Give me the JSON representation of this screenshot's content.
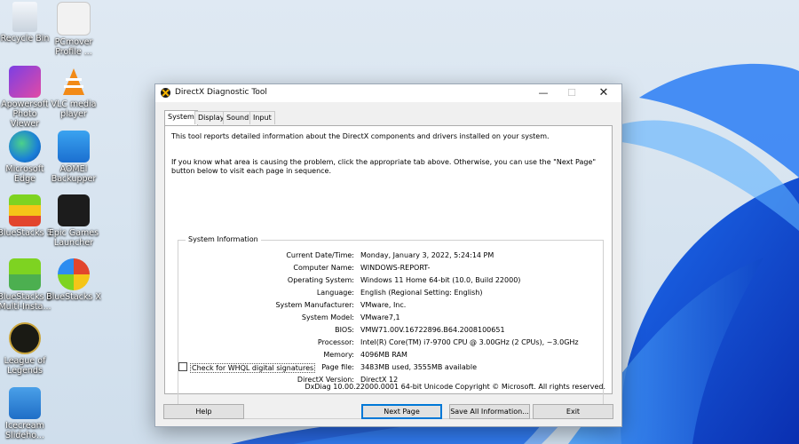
{
  "desktop": {
    "icons": [
      {
        "label": "Recycle Bin",
        "icon": "recycle-bin-icon"
      },
      {
        "label": "PCmover Profile ...",
        "icon": "pcmover-icon"
      },
      {
        "label": "Apowersoft Photo Viewer",
        "icon": "apowersoft-icon"
      },
      {
        "label": "VLC media player",
        "icon": "vlc-icon"
      },
      {
        "label": "Microsoft Edge",
        "icon": "edge-icon"
      },
      {
        "label": "AOMEI Backupper",
        "icon": "aomei-icon"
      },
      {
        "label": "BlueStacks 5",
        "icon": "bluestacks-icon"
      },
      {
        "label": "Epic Games Launcher",
        "icon": "epic-games-icon"
      },
      {
        "label": "BlueStacks 5 Multi-Insta...",
        "icon": "bluestacks-multi-icon"
      },
      {
        "label": "BlueStacks X",
        "icon": "bluestacks-x-icon"
      },
      {
        "label": "League of Legends",
        "icon": "league-icon"
      },
      {
        "label": "Icecream Slideho...",
        "icon": "icecream-icon"
      }
    ]
  },
  "window": {
    "title": "DirectX Diagnostic Tool",
    "minimize": "—",
    "maximize": "☐",
    "close": "✕",
    "tabs": [
      "System",
      "Display",
      "Sound",
      "Input"
    ],
    "intro": "This tool reports detailed information about the DirectX components and drivers installed on your system.",
    "hint": "If you know what area is causing the problem, click the appropriate tab above.  Otherwise, you can use the \"Next Page\" button below to visit each page in sequence.",
    "group_title": "System Information",
    "rows": [
      {
        "key": "Current Date/Time:",
        "value": "Monday, January 3, 2022, 5:24:14 PM"
      },
      {
        "key": "Computer Name:",
        "value": "WINDOWS-REPORT-"
      },
      {
        "key": "Operating System:",
        "value": "Windows 11 Home 64-bit (10.0, Build 22000)"
      },
      {
        "key": "Language:",
        "value": "English (Regional Setting: English)"
      },
      {
        "key": "System Manufacturer:",
        "value": "VMware, Inc."
      },
      {
        "key": "System Model:",
        "value": "VMware7,1"
      },
      {
        "key": "BIOS:",
        "value": "VMW71.00V.16722896.B64.2008100651"
      },
      {
        "key": "Processor:",
        "value": "Intel(R) Core(TM) i7-9700 CPU @ 3.00GHz (2 CPUs), ~3.0GHz"
      },
      {
        "key": "Memory:",
        "value": "4096MB RAM"
      },
      {
        "key": "Page file:",
        "value": "3483MB used, 3555MB available"
      },
      {
        "key": "DirectX Version:",
        "value": "DirectX 12"
      }
    ],
    "whql_label": "Check for WHQL digital signatures",
    "copyright": "DxDiag 10.00.22000.0001 64-bit Unicode  Copyright © Microsoft. All rights reserved.",
    "buttons": {
      "help": "Help",
      "next": "Next Page",
      "save": "Save All Information...",
      "exit": "Exit"
    }
  }
}
